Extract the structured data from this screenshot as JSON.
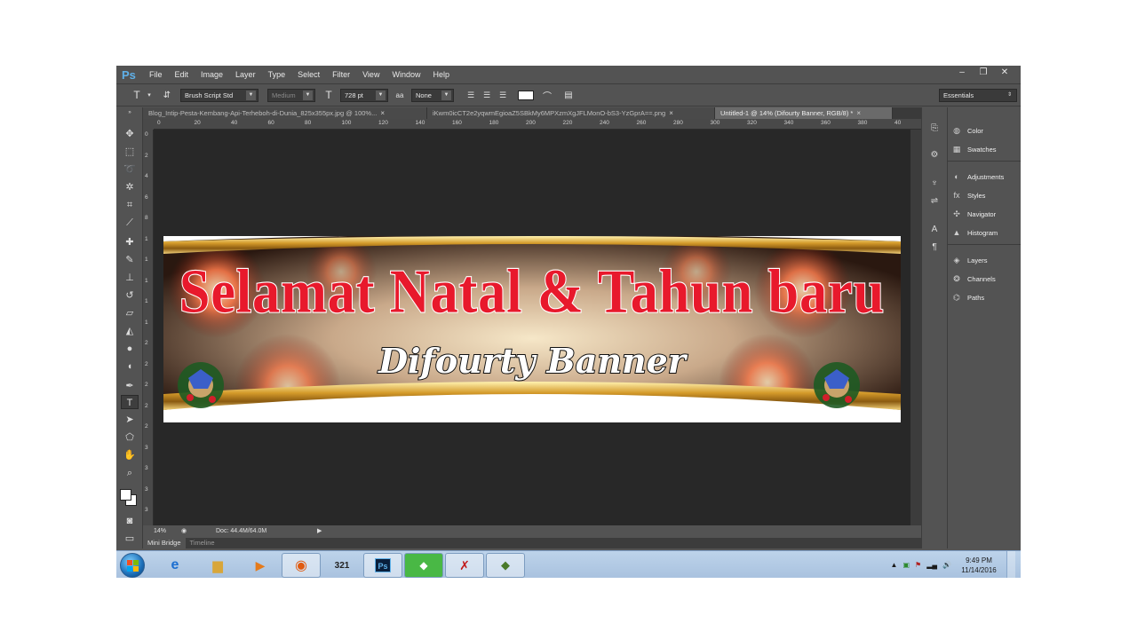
{
  "app": {
    "logo": "Ps",
    "menu": [
      "File",
      "Edit",
      "Image",
      "Layer",
      "Type",
      "Select",
      "Filter",
      "View",
      "Window",
      "Help"
    ],
    "window_controls": [
      "–",
      "❐",
      "✕"
    ]
  },
  "options": {
    "font_family": "Brush Script Std",
    "font_style": "Medium",
    "font_size": "728 pt",
    "antialias_icon": "aa",
    "antialias": "None",
    "workspace": "Essentials"
  },
  "tabs": [
    {
      "label": "Blog_Intip-Pesta-Kembang-Api-Terheboh-di-Dunia_825x355px.jpg @ 100%...",
      "active": false
    },
    {
      "label": "iKwm0icCT2e2yqwmEgioaZ5SBkMy6MPXzmXgJFLMonO-bS3-YzGprA==.png",
      "active": false
    },
    {
      "label": "Untitled-1 @ 14% (Difourty Banner, RGB/8) *",
      "active": true
    }
  ],
  "ruler": {
    "top_labels": [
      "0",
      "20",
      "40",
      "60",
      "80",
      "100",
      "120",
      "140",
      "160",
      "180",
      "200",
      "220",
      "240",
      "260",
      "280",
      "300",
      "320",
      "340",
      "360",
      "380",
      "40"
    ],
    "left_labels": [
      "0",
      "2",
      "4",
      "6",
      "8",
      "1",
      "1",
      "1",
      "1",
      "1",
      "2",
      "2",
      "2",
      "2",
      "2",
      "3",
      "3",
      "3",
      "3"
    ]
  },
  "banner": {
    "title": "Selamat Natal & Tahun baru",
    "subtitle": "Difourty Banner"
  },
  "status": {
    "zoom": "14%",
    "doc": "Doc: 44.4M/64.0M"
  },
  "bottom_tabs": [
    "Mini Bridge",
    "Timeline"
  ],
  "panels": {
    "group1": [
      "Color",
      "Swatches"
    ],
    "group2": [
      "Adjustments",
      "Styles",
      "Navigator",
      "Histogram"
    ],
    "group3": [
      "Layers",
      "Channels",
      "Paths"
    ]
  },
  "taskbar": {
    "time": "9:49 PM",
    "date": "11/14/2016"
  },
  "colors": {
    "accent_red": "#e8192c",
    "ps_blue": "#5fb0e8"
  }
}
